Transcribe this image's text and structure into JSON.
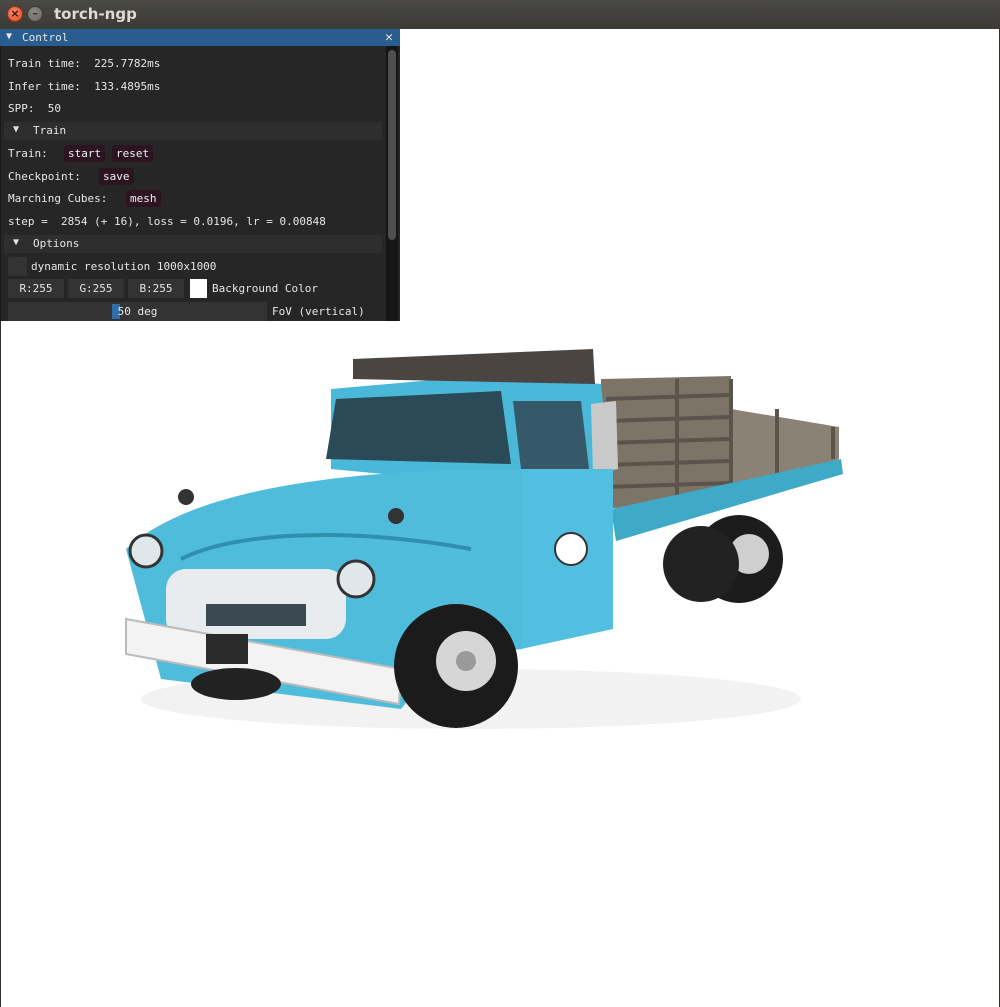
{
  "window": {
    "title": "torch-ngp"
  },
  "panel": {
    "title": "Control",
    "train_time": "Train time:  225.7782ms",
    "infer_time": "Infer time:  133.4895ms",
    "spp": "SPP:  50",
    "train_section": {
      "title": "Train",
      "train_label": "Train:",
      "start_button": "start",
      "reset_button": "reset",
      "checkpoint_label": "Checkpoint:",
      "save_button": "save",
      "marching_label": "Marching Cubes:",
      "mesh_button": "mesh",
      "status": "step =  2854 (+ 16), loss = 0.0196, lr = 0.00848"
    },
    "options_section": {
      "title": "Options",
      "dynamic_resolution": "dynamic resolution 1000x1000",
      "r": "R:255",
      "g": "G:255",
      "b": "B:255",
      "background_color_label": "Background Color",
      "fov_value": "50 deg",
      "fov_label": "FoV (vertical)"
    }
  },
  "colors": {
    "panel_header": "#2a5d8f",
    "background": "#ffffff",
    "truck_body": "#4ab8d8"
  },
  "icons": {
    "close": "close-icon",
    "minimize": "minimize-icon",
    "collapse": "triangle-down-icon"
  }
}
